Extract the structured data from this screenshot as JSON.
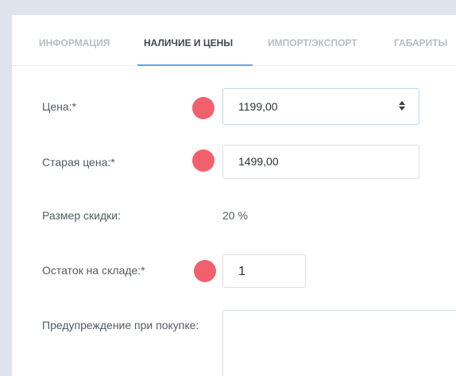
{
  "tabs": [
    {
      "label": "ИНФОРМАЦИЯ",
      "active": false
    },
    {
      "label": "НАЛИЧИЕ И ЦЕНЫ",
      "active": true
    },
    {
      "label": "ИМПОРТ/ЭКСПОРТ",
      "active": false
    },
    {
      "label": "ГАБАРИТЫ",
      "active": false
    }
  ],
  "form": {
    "price_label": "Цена:*",
    "price_value": "1199,00",
    "old_price_label": "Старая цена:*",
    "old_price_value": "1499,00",
    "discount_label": "Размер скидки:",
    "discount_value": "20 %",
    "stock_label": "Остаток на складе:*",
    "stock_value": "1",
    "warning_label": "Предупреждение при покупке:",
    "warning_value": ""
  },
  "colors": {
    "marker": "#f2606d",
    "accent": "#5ca6e6"
  },
  "icons": {
    "price_spinner": "up-down-arrows-icon",
    "required_marker": "red-dot-marker"
  }
}
